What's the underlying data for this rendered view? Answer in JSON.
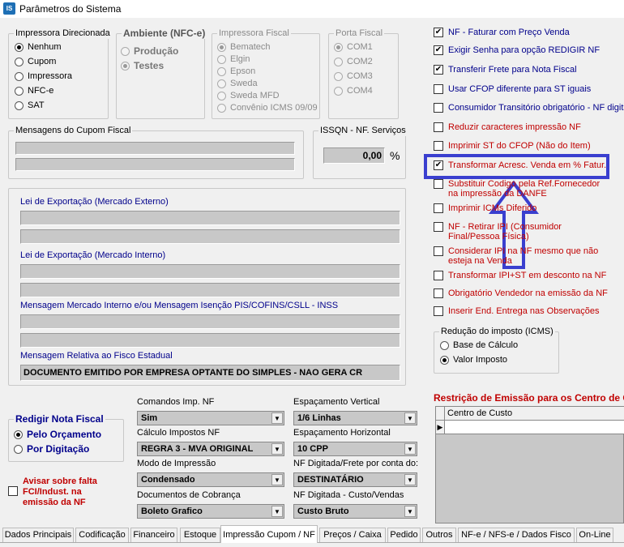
{
  "window": {
    "icon": "IS",
    "title": "Parâmetros do Sistema"
  },
  "printer_group": {
    "title": "Impressora Direcionada",
    "options": [
      "Nenhum",
      "Cupom",
      "Impressora",
      "NFC-e",
      "SAT"
    ],
    "selected": 0
  },
  "environment_group": {
    "title": "Ambiente (NFC-e)",
    "options": [
      "Produção",
      "Testes"
    ],
    "selected": 1
  },
  "fiscal_printer_group": {
    "title": "Impressora Fiscal",
    "options": [
      "Bematech",
      "Elgin",
      "Epson",
      "Sweda",
      "Sweda MFD",
      "Convênio ICMS 09/09"
    ],
    "selected": 0
  },
  "fiscal_port_group": {
    "title": "Porta Fiscal",
    "options": [
      "COM1",
      "COM2",
      "COM3",
      "COM4"
    ],
    "selected": 0
  },
  "coupon_messages": {
    "title": "Mensagens do Cupom Fiscal"
  },
  "issqn": {
    "title": "ISSQN - NF. Serviços",
    "value": "0,00",
    "unit": "%"
  },
  "laws": {
    "export_external_label": "Lei de Exportação (Mercado Externo)",
    "export_internal_label": "Lei de Exportação (Mercado Interno)",
    "pis_cofins_label": "Mensagem Mercado Interno e/ou Mensagem Isenção PIS/COFINS/CSLL - INSS",
    "state_fisco_label": "Mensagem Relativa ao Fisco Estadual",
    "state_fisco_value": "DOCUMENTO EMITIDO POR EMPRESA OPTANTE DO SIMPLES - NAO GERA CR"
  },
  "options": [
    {
      "label": "NF - Faturar com Preço Venda",
      "checked": true,
      "color": "blue"
    },
    {
      "label": "Exigir Senha para opção REDIGIR NF",
      "checked": true,
      "color": "blue"
    },
    {
      "label": "Transferir Frete para Nota Fiscal",
      "checked": true,
      "color": "blue"
    },
    {
      "label": "Usar CFOP diferente para ST iguais",
      "checked": false,
      "color": "blue"
    },
    {
      "label": "Consumidor Transitório obrigatório - NF digitad",
      "checked": false,
      "color": "blue"
    },
    {
      "label": "Reduzir caracteres impressão NF",
      "checked": false,
      "color": "red"
    },
    {
      "label": "Imprimir ST do CFOP (Não do Item)",
      "checked": false,
      "color": "red"
    },
    {
      "label": "Transformar Acresc. Venda em % Fatur.",
      "checked": true,
      "color": "red"
    },
    {
      "label": "Substituir Codigo pela Ref.Fornecedor na impressão da DANFE",
      "checked": false,
      "color": "red"
    },
    {
      "label": "Imprimir ICMs Diferido",
      "checked": false,
      "color": "red"
    },
    {
      "label": "NF - Retirar IPI (Consumidor Final/Pessoa Física)",
      "checked": false,
      "color": "red"
    },
    {
      "label": "Considerar IPI na NF mesmo que não esteja na Venda",
      "checked": false,
      "color": "red"
    },
    {
      "label": "Transformar IPI+ST em desconto na NF",
      "checked": false,
      "color": "red"
    },
    {
      "label": "Obrigatório Vendedor na emissão da NF",
      "checked": false,
      "color": "red"
    },
    {
      "label": "Inserir End. Entrega nas Observações",
      "checked": false,
      "color": "red"
    }
  ],
  "tax_reduction": {
    "title": "Redução do imposto (ICMS)",
    "options": [
      "Base de Cálculo",
      "Valor Imposto"
    ],
    "selected": 1
  },
  "redigir": {
    "title": "Redigir Nota Fiscal",
    "options": [
      "Pelo Orçamento",
      "Por Digitação"
    ],
    "selected": 0
  },
  "fci_warning": {
    "label": "Avisar sobre falta FCI/Indust. na emissão da NF",
    "checked": false
  },
  "selects": [
    {
      "label": "Comandos Imp. NF",
      "value": "Sim"
    },
    {
      "label": "Espaçamento Vertical",
      "value": "1/6 Linhas"
    },
    {
      "label": "Cálculo Impostos NF",
      "value": "REGRA 3 - MVA ORIGINAL"
    },
    {
      "label": "Espaçamento Horizontal",
      "value": "10 CPP"
    },
    {
      "label": "Modo de Impressão",
      "value": "Condensado"
    },
    {
      "label": "NF Digitada/Frete por conta do:",
      "value": "DESTINATÁRIO"
    },
    {
      "label": "Documentos de Cobrança",
      "value": "Boleto Grafico"
    },
    {
      "label": "NF Digitada - Custo/Vendas",
      "value": "Custo Bruto"
    }
  ],
  "restriction": {
    "title": "Restrição de Emissão para os Centro de C",
    "column": "Centro de Custo"
  },
  "tabs": [
    "Dados Principais",
    "Codificação",
    "Financeiro",
    "Estoque",
    "Impressão Cupom / NF",
    "Preços / Caixa",
    "Pedido",
    "Outros",
    "NF-e / NFS-e / Dados Fisco",
    "On-Line"
  ],
  "active_tab": 4,
  "colors": {
    "annotation": "#3a3fcf",
    "blue_text": "#00008b",
    "red_text": "#c00000"
  },
  "icons": {
    "annotation_arrow": "up-arrow-icon"
  }
}
